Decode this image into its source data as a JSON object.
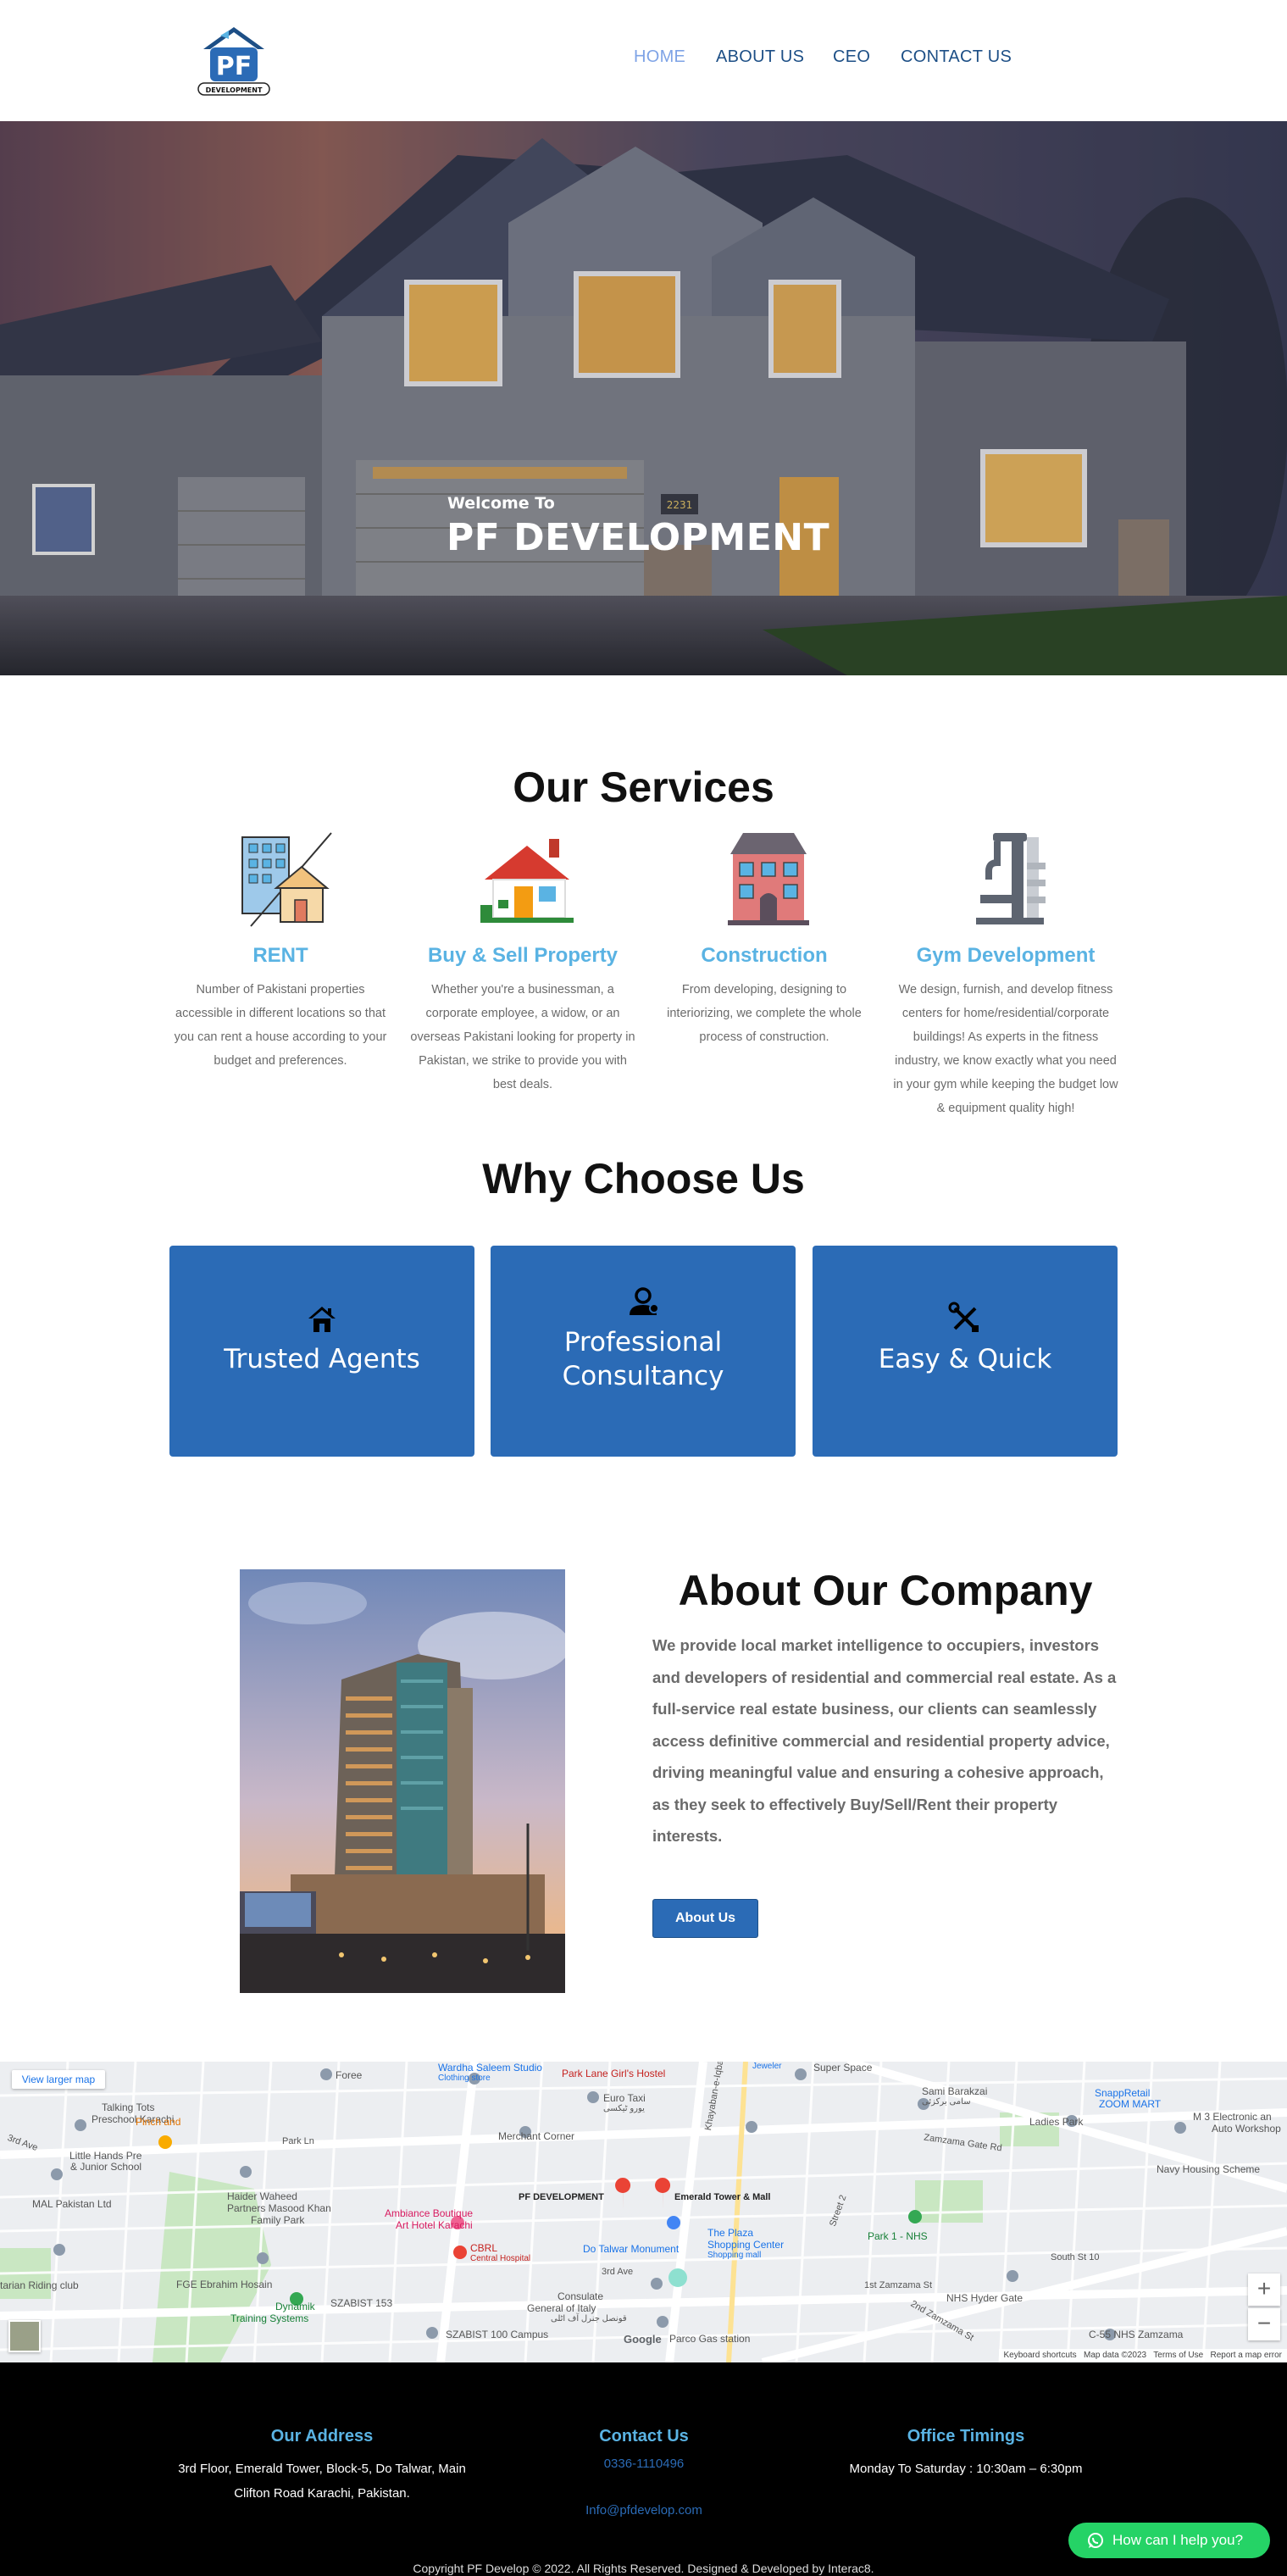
{
  "brand": {
    "logo_letters": "PF",
    "logo_caption": "DEVELOPMENT"
  },
  "nav": {
    "items": [
      {
        "label": "HOME",
        "active": true
      },
      {
        "label": "ABOUT US",
        "active": false
      },
      {
        "label": "CEO",
        "active": false
      },
      {
        "label": "CONTACT US",
        "active": false
      }
    ]
  },
  "hero": {
    "welcome": "Welcome To",
    "title": "PF DEVELOPMENT",
    "house_number": "2231"
  },
  "services": {
    "title": "Our Services",
    "items": [
      {
        "title": "RENT",
        "icon": "rent-building-house-icon",
        "text": "Number of Pakistani properties accessible in different locations so that you can rent a house according to your budget and preferences."
      },
      {
        "title": "Buy & Sell Property",
        "icon": "house-for-sale-icon",
        "text": "Whether you're a businessman, a corporate employee, a widow, or an overseas Pakistani looking for property in Pakistan, we strike to provide you with best deals."
      },
      {
        "title": "Construction",
        "icon": "construction-building-icon",
        "text": "From developing, designing to interiorizing, we complete the whole process of construction."
      },
      {
        "title": "Gym Development",
        "icon": "gym-machine-icon",
        "text": "We design, furnish, and develop fitness centers for home/residential/corporate buildings! As experts in the fitness industry, we know exactly what you need in your gym while keeping the budget low & equipment quality high!"
      }
    ]
  },
  "why": {
    "title": "Why Choose Us",
    "cards": [
      {
        "label": "Trusted Agents",
        "icon": "house-icon"
      },
      {
        "label_line1": "Professional",
        "label_line2": "Consultancy",
        "icon": "user-consultant-icon"
      },
      {
        "label": "Easy & Quick",
        "icon": "tools-icon"
      }
    ]
  },
  "about": {
    "title": "About Our Company",
    "text": "We provide local market intelligence to occupiers, investors and developers of residential and commercial real estate. As a full-service real estate business, our clients can seamlessly access definitive commercial and residential property advice, driving meaningful value and ensuring a cohesive approach, as they seek to effectively Buy/Sell/Rent their property interests.",
    "button": "About Us"
  },
  "map": {
    "view_larger": "View larger map",
    "labels": {
      "wardha": "Wardha Saleem Studio",
      "wardha_sub": "Clothing store",
      "parklane": "Park Lane Girl's Hostel",
      "jeweler": "Jeweler",
      "superspace": "Super Space",
      "foree": "Foree",
      "eurotaxi": "Euro Taxi",
      "eurotaxi_urdu": "یورو ٹیکسی",
      "sami": "Sami Barakzai",
      "sami_urdu": "سامی برکزئی",
      "snapp": "SnappRetail",
      "snapp2": "ZOOM MART",
      "m3": "M 3 Electronic an",
      "m3b": "Auto Workshop",
      "talking": "Talking Tots",
      "talking2": "Preschool Karachi",
      "pinch": "Pinch and",
      "parkln": "Park Ln",
      "merchant": "Merchant Corner",
      "ladies": "Ladies Park",
      "little": "Little Hands Pre",
      "little2": "& Junior School",
      "zamzama_gate": "Zamzama Gate Rd",
      "navy": "Navy Housing Scheme",
      "haider": "Haider Waheed",
      "haider2": "Partners Masood Khan",
      "family": "Family Park",
      "ambiance": "Ambiance Boutique",
      "ambiance2": "Art Hotel Karachi",
      "pfdev": "PF DEVELOPMENT",
      "emerald": "Emerald Tower & Mall",
      "mall": "Mall",
      "cbrl": "CBRL",
      "cbrl2": "Central Hospital",
      "dotalwar": "Do Talwar Monument",
      "plaza": "The Plaza",
      "plaza2": "Shopping Center",
      "plaza3": "Shopping mall",
      "park1": "Park 1 - NHS",
      "south": "South St 10",
      "pakistan": "MAL Pakistan Ltd",
      "riding": "tarian Riding club",
      "fge": "FGE Ebrahim Hosain",
      "dynamik": "Dynamik",
      "training": "Training Systems",
      "szabist": "SZABIST 153",
      "zamzama1": "1st Zamzama St",
      "nhs": "NHS Hyder Gate",
      "consulate": "Consulate",
      "consulate2": "General of Italy",
      "consulate3": "قونصل جنرل آف اٹلی",
      "szabist100": "SZABIST 100 Campus",
      "parco": "Parco Gas station",
      "c55": "C-55 NHS Zamzama",
      "khayaban": "Khayaban-e-Iqbal",
      "ave": "3rd Ave",
      "ave3": "3rd Ave",
      "street2": "Street 2",
      "zamzama2": "2nd Zamzama St",
      "google": "Google",
      "shortcuts": "Keyboard shortcuts",
      "mapdata": "Map data ©2023",
      "terms": "Terms of Use",
      "report": "Report a map error"
    }
  },
  "footer": {
    "address_title": "Our Address",
    "address_line1": "3rd Floor, Emerald Tower, Block-5, Do Talwar, Main",
    "address_line2": "Clifton Road Karachi, Pakistan.",
    "contact_title": "Contact Us",
    "phone": "0336-1110496",
    "email": "Info@pfdevelop.com",
    "timings_title": "Office Timings",
    "timings": "Monday To Saturday : 10:30am – 6:30pm",
    "copyright": "Copyright PF Develop © 2022. All Rights Reserved. Designed & Developed by Interac8.",
    "whatsapp": "How can I help you?"
  },
  "colors": {
    "accent": "#2b6bb6",
    "service_title": "#5ab3e3",
    "nav_active": "#7ea3e6",
    "whatsapp": "#25d366"
  }
}
